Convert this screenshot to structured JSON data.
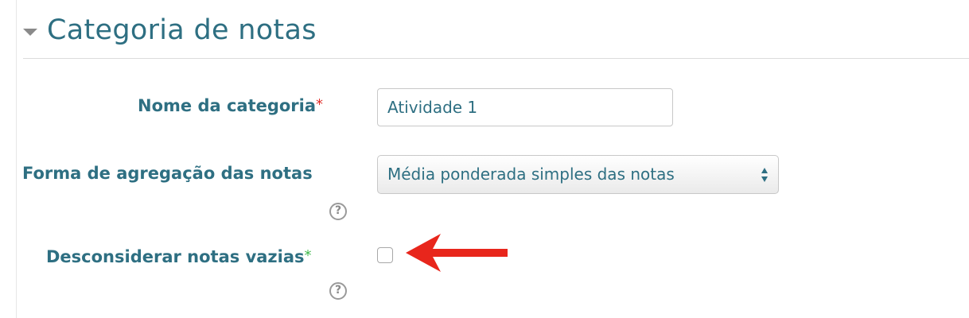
{
  "section": {
    "title": "Categoria de notas",
    "toggle_icon": "collapse-triangle-icon"
  },
  "fields": {
    "category_name": {
      "label": "Nome da categoria",
      "required_marker": "*",
      "value": "Atividade 1"
    },
    "aggregation": {
      "label": "Forma de agregação das notas",
      "selected": "Média ponderada simples das notas",
      "help_icon": "help-question-icon",
      "help_glyph": "?"
    },
    "exclude_empty": {
      "label": "Desconsiderar notas vazias",
      "advanced_marker": "*",
      "checked": false,
      "help_icon": "help-question-icon",
      "help_glyph": "?"
    }
  },
  "annotation": {
    "arrow_color": "#e8261c",
    "icon": "red-arrow-icon"
  },
  "colors": {
    "label_text": "#2e6f82",
    "required_marker": "#e0302b",
    "advanced_marker": "#3db84a"
  }
}
